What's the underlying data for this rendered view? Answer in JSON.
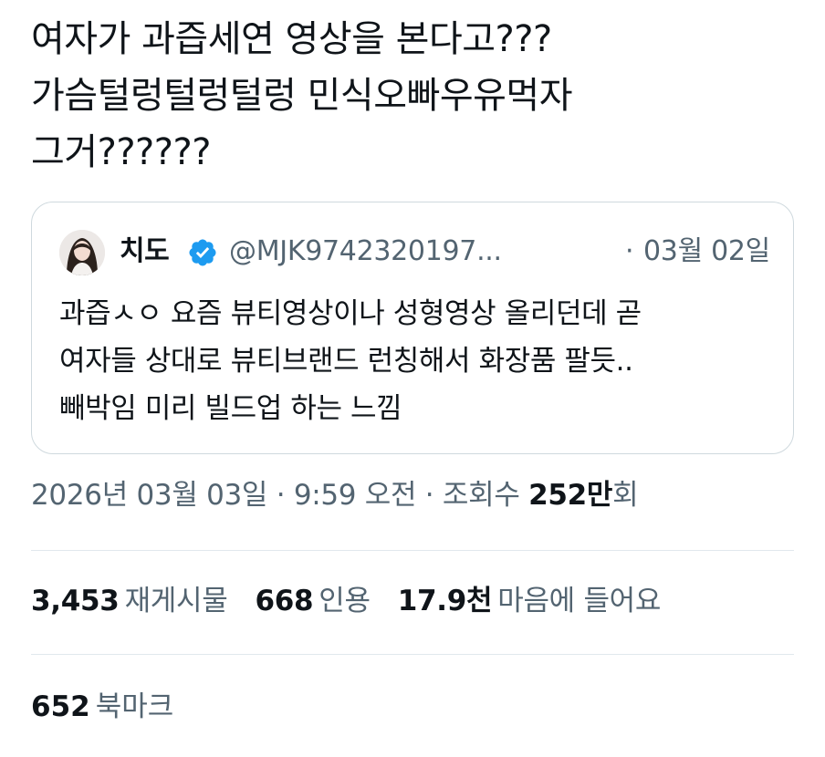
{
  "tweet": {
    "lines": [
      "여자가 과즙세연 영상을 본다고???",
      "가슴털렁털렁털렁 민식오빠우유먹자",
      "그거??????"
    ]
  },
  "quote": {
    "avatar_icon": "profile-avatar",
    "display_name": "치도",
    "verified_icon": "verified-badge-icon",
    "verified_color": "#1d9bf0",
    "handle": "@MJK9742320197...",
    "separator": "·",
    "date": "03월 02일",
    "body_lines": [
      "과즙ㅅㅇ 요즘 뷰티영상이나 성형영상 올리던데 곧",
      "여자들 상대로 뷰티브랜드 런칭해서 화장품 팔듯..",
      "빼박임 미리 빌드업 하는 느낌"
    ]
  },
  "meta": {
    "timestamp": "2026년 03월 03일 · 9:59 오전 · 조회수 ",
    "views_count": "252만",
    "views_suffix": "회"
  },
  "stats": {
    "reposts_count": "3,453",
    "reposts_label": "재게시물",
    "quotes_count": "668",
    "quotes_label": "인용",
    "likes_count": "17.9천",
    "likes_label": "마음에 들어요",
    "bookmarks_count": "652",
    "bookmarks_label": "북마크"
  },
  "colors": {
    "text_primary": "#0f1419",
    "text_secondary": "#536471",
    "border": "#cfd9de",
    "accent": "#1d9bf0"
  }
}
